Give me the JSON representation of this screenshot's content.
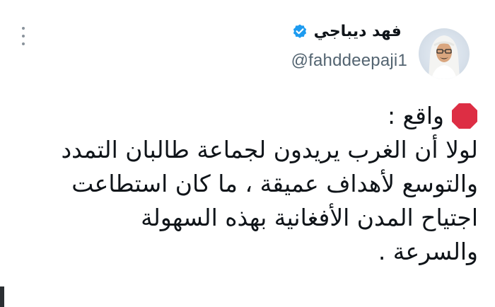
{
  "tweet": {
    "author": {
      "display_name": "فهد ديباجي",
      "handle": "@fahddeepaji1",
      "verified": true
    },
    "body": {
      "lead": "واقع :",
      "lines": [
        "لولا أن الغرب يريدون لجماعة طالبان التمدد",
        "والتوسع لأهداف عميقة ، ما كان استطاعت",
        "اجتياح المدن الأفغانية بهذه السهولة",
        "والسرعة ."
      ]
    },
    "icons": {
      "more": "more-options-icon",
      "verified": "verified-badge-icon",
      "stop": "octagonal-stop-sign-icon"
    },
    "colors": {
      "verified_blue": "#1d9bf0",
      "stop_red": "#dd2e44",
      "handle_gray": "#536471"
    }
  }
}
